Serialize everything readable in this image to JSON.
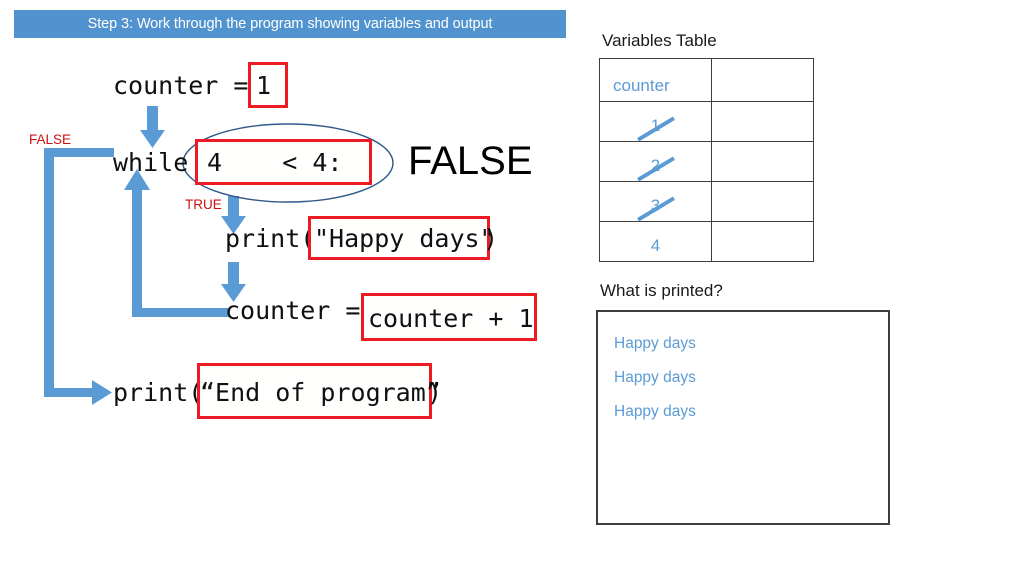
{
  "banner": {
    "text": "Step 3: Work through the program showing variables and output",
    "bg": "#5193CE",
    "fg": "#ffffff"
  },
  "colors": {
    "accent_blue": "#5B9BD5",
    "banner_blue": "#5193CE",
    "highlight_red": "#ED1C24",
    "tag_red": "#CC1111",
    "ellipse_outline": "#2E5A88",
    "table_border": "#3d3d3d"
  },
  "code": {
    "line1_text": "counter = ",
    "line1_box_value": "1",
    "line2_keyword": "while",
    "line2_box_value": "4    < 4:",
    "line2_result": "FALSE",
    "line3_text_prefix": "print(",
    "line3_box_value": "\"Happy days\"",
    "line3_text_suffix": ")",
    "line4_text": "counter = ",
    "line4_box_value": "counter + 1",
    "line5_text_prefix": "print(",
    "line5_box_value": "“End of program”",
    "line5_text_suffix": ")"
  },
  "flow": {
    "false_label": "FALSE",
    "true_label": "TRUE"
  },
  "variables_panel": {
    "heading": "Variables Table",
    "columns": [
      "counter",
      ""
    ],
    "rows": [
      {
        "counter": "1",
        "struck": true,
        "other": ""
      },
      {
        "counter": "2",
        "struck": true,
        "other": ""
      },
      {
        "counter": "3",
        "struck": true,
        "other": ""
      },
      {
        "counter": "4",
        "struck": false,
        "other": ""
      }
    ]
  },
  "output_panel": {
    "heading": "What is printed?",
    "lines": [
      "Happy days",
      "Happy days",
      "Happy days"
    ]
  },
  "icons": {
    "down_arrow": "down-arrow-icon",
    "up_arrow": "up-arrow-icon",
    "right_arrow": "right-arrow-icon",
    "ellipse": "ellipse-highlight-icon"
  }
}
